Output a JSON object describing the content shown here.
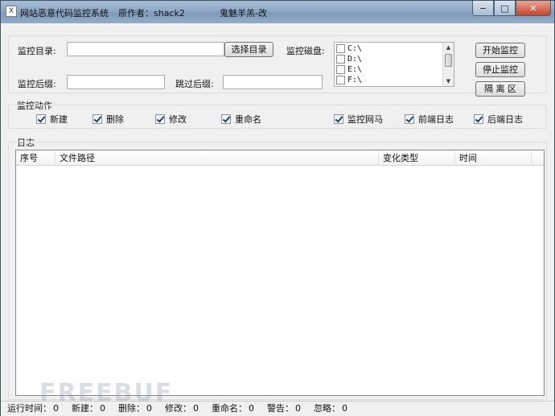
{
  "titlebar": {
    "app_icon_glyph": "X",
    "title": "网站恶意代码监控系统",
    "author": "原作者：shack2",
    "modifier": "鬼魅羊羔-改",
    "minimize": "−",
    "maximize": "□",
    "close": "✕"
  },
  "config": {
    "monitor_dir_label": "监控目录:",
    "monitor_dir_value": "",
    "select_dir_button": "选择目录",
    "monitor_suffix_label": "监控后缀:",
    "monitor_suffix_value": "",
    "skip_suffix_label": "跳过后缀:",
    "skip_suffix_value": "",
    "monitor_disk_label": "监控磁盘:",
    "disks": [
      "C:\\",
      "D:\\",
      "E:\\",
      "F:\\"
    ]
  },
  "controls": {
    "start_button": "开始监控",
    "stop_button": "停止监控",
    "isolate_button": "隔 离 区"
  },
  "actions": {
    "group_label": "监控动作",
    "items": [
      "新建",
      "删除",
      "修改",
      "重命名",
      "监控网马",
      "前端日志",
      "后端日志"
    ]
  },
  "log": {
    "group_label": "日志",
    "columns": [
      "序号",
      "文件路径",
      "变化类型",
      "时间"
    ],
    "rows": []
  },
  "status": {
    "runtime_label": "运行时间：",
    "runtime_value": "0",
    "new_label": "新建：",
    "new_value": "0",
    "delete_label": "删除：",
    "delete_value": "0",
    "modify_label": "修改：",
    "modify_value": "0",
    "rename_label": "重命名：",
    "rename_value": "0",
    "alert_label": "警告：",
    "alert_value": "0",
    "ignore_label": "忽略：",
    "ignore_value": "0"
  },
  "watermark": "FREEBUF"
}
